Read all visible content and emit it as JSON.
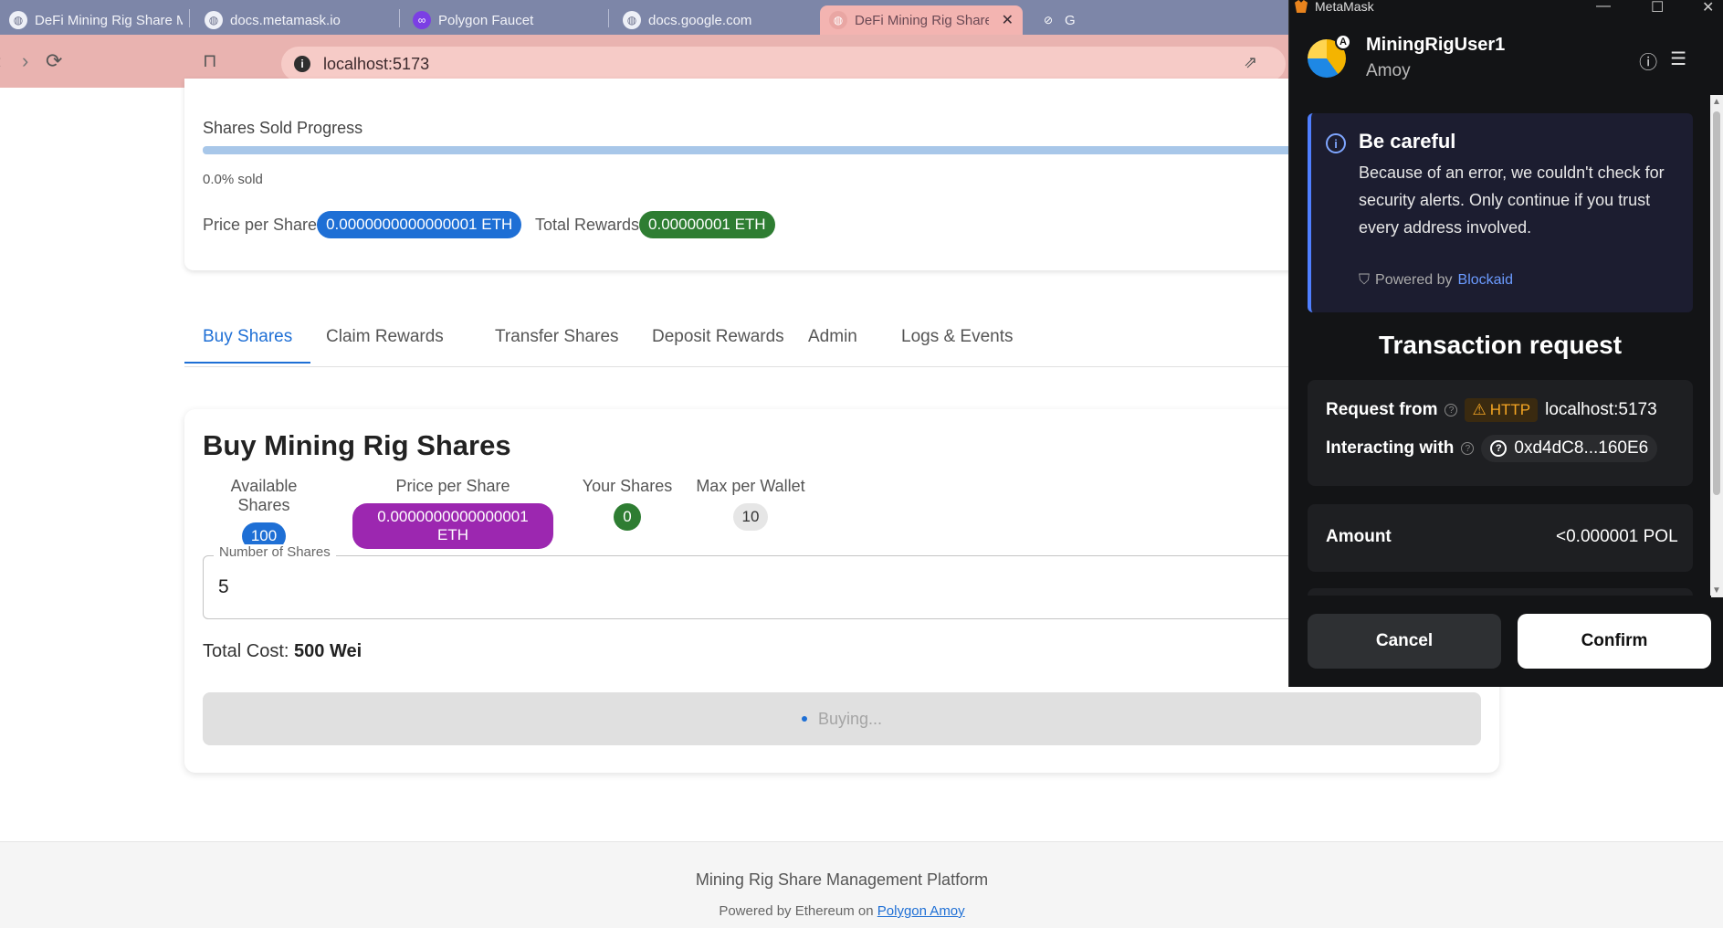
{
  "browser": {
    "tabs": [
      {
        "title": "DeFi Mining Rig Share Managem",
        "icon": "globe-icon",
        "active": false
      },
      {
        "title": "docs.metamask.io",
        "icon": "globe-icon",
        "active": false
      },
      {
        "title": "Polygon Faucet",
        "icon": "polygon-icon",
        "active": false
      },
      {
        "title": "docs.google.com",
        "icon": "globe-icon",
        "active": false
      },
      {
        "title": "DeFi Mining Rig Share Man",
        "icon": "globe-icon",
        "active": true
      },
      {
        "title": "G",
        "icon": "link-icon",
        "active": false
      }
    ],
    "url": "localhost:5173"
  },
  "progress": {
    "label": "Shares Sold Progress",
    "sold_fraction": 0.0,
    "sold_text": "0.0% sold",
    "price_label": "Price per Share",
    "price_value": "0.0000000000000001 ETH",
    "rewards_label": "Total Rewards",
    "rewards_value": "0.00000001 ETH"
  },
  "nav_tabs": [
    {
      "label": "Buy Shares",
      "active": true
    },
    {
      "label": "Claim Rewards",
      "active": false
    },
    {
      "label": "Transfer Shares",
      "active": false
    },
    {
      "label": "Deposit Rewards",
      "active": false
    },
    {
      "label": "Admin",
      "active": false
    },
    {
      "label": "Logs & Events",
      "active": false
    }
  ],
  "buy": {
    "title": "Buy Mining Rig Shares",
    "stats": [
      {
        "label": "Available Shares",
        "value": "100",
        "color": "#1e6fd5"
      },
      {
        "label": "Price per Share",
        "value": "0.0000000000000001 ETH",
        "color": "#9c27b0"
      },
      {
        "label": "Your Shares",
        "value": "0",
        "color": "#2e7d32"
      },
      {
        "label": "Max per Wallet",
        "value": "10",
        "color": "#e6e6e6"
      }
    ],
    "field_label": "Number of Shares",
    "field_value": "5",
    "total_cost_label": "Total Cost:",
    "total_cost_value": "500 Wei",
    "button_label": "Buying..."
  },
  "footer": {
    "title": "Mining Rig Share Management Platform",
    "powered_prefix": "Powered by Ethereum on",
    "powered_link": "Polygon Amoy"
  },
  "metamask": {
    "window_title": "MetaMask",
    "account_name": "MiningRigUser1",
    "network": "Amoy",
    "avatar_badge": "A",
    "alert": {
      "title": "Be careful",
      "body": "Because of an error, we couldn't check for security alerts. Only continue if you trust every address involved.",
      "powered_prefix": "Powered by",
      "powered_link": "Blockaid"
    },
    "tx_title": "Transaction request",
    "request_from_label": "Request from",
    "http_tag": "HTTP",
    "request_from_value": "localhost:5173",
    "interacting_label": "Interacting with",
    "interacting_value": "0xd4dC8...160E6",
    "amount_label": "Amount",
    "amount_value": "<0.000001 POL",
    "cancel_label": "Cancel",
    "confirm_label": "Confirm"
  },
  "colors": {
    "accent": "#1e6fd5",
    "green": "#2e7d32",
    "purple": "#9c27b0",
    "metamask_bg": "#131416"
  }
}
